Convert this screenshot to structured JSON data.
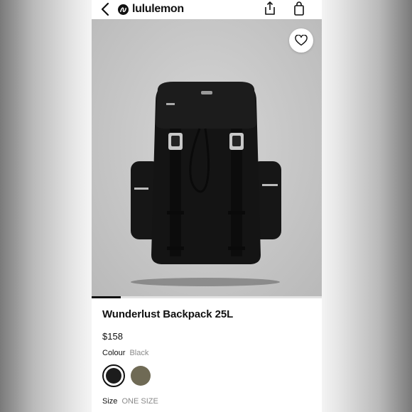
{
  "header": {
    "brand": "lululemon",
    "icons": [
      "back-chevron-icon",
      "lululemon-logo-icon",
      "share-icon",
      "shopping-bag-icon"
    ]
  },
  "product": {
    "name": "Wunderlust Backpack 25L",
    "price": "$158",
    "colour_label": "Colour",
    "colour_selected": "Black",
    "swatches": [
      {
        "name": "Black",
        "color": "#1c1c1c",
        "selected": true
      },
      {
        "name": "Olive",
        "color": "#6f6a55",
        "selected": false
      }
    ],
    "size_label": "Size",
    "size_value": "ONE SIZE"
  },
  "gallery": {
    "image_progress": 0.125,
    "favorite_icon": "heart-icon"
  },
  "colors": {
    "text": "#111111",
    "muted": "#8a8a8a",
    "image_bg": "#c6c6c6",
    "product": "#141414"
  }
}
